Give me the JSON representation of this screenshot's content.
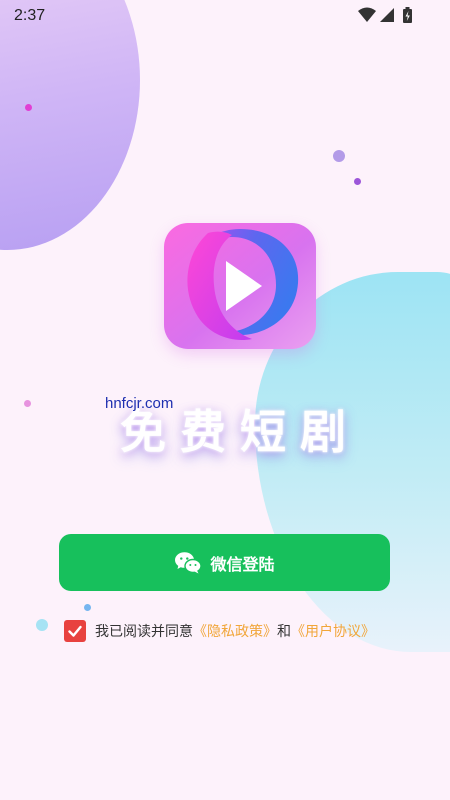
{
  "status_bar": {
    "time": "2:37",
    "icons": [
      "wifi-icon",
      "signal-icon",
      "battery-charging-icon"
    ]
  },
  "app": {
    "logo_icon": "play-logo-icon",
    "title": "免费短剧",
    "watermark": "hnfcjr.com"
  },
  "login": {
    "icon": "wechat-icon",
    "label": "微信登陆"
  },
  "agreement": {
    "checked": true,
    "prefix": "我已阅读并同意",
    "privacy_link": "《隐私政策》",
    "conjunction": "和",
    "terms_link": "《用户协议》"
  },
  "colors": {
    "background": "#fdf2fb",
    "button_green": "#17c05c",
    "checkbox_red": "#e8423f",
    "link_orange": "#f1a63a",
    "watermark_blue": "#1e2fb0"
  }
}
